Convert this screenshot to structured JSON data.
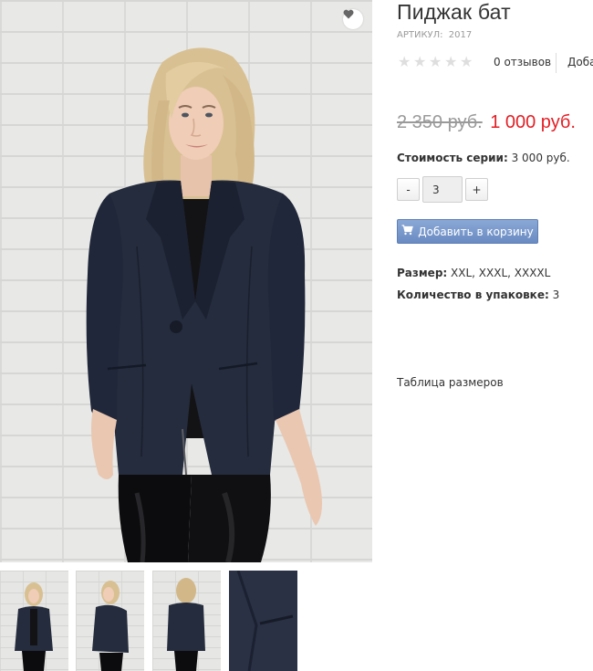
{
  "product": {
    "title": "Пиджак бат",
    "sku_label": "АРТИКУЛ:",
    "sku_value": "2017"
  },
  "rating": {
    "stars_filled": 0,
    "stars_total": 5,
    "reviews_label": "0 отзывов",
    "add_review_label": "Доба"
  },
  "price": {
    "old": "2 350 руб.",
    "new": "1 000 руб."
  },
  "series": {
    "label": "Стоимость серии:",
    "value": "3 000 руб."
  },
  "quantity": {
    "minus_label": "-",
    "value": "3",
    "plus_label": "+"
  },
  "cart": {
    "button_label": "Добавить в корзину",
    "icon": "cart-icon"
  },
  "attributes": {
    "size_label": "Размер:",
    "size_value": "XXL, XXXL, XXXXL",
    "pack_label": "Количество в упаковке:",
    "pack_value": "3"
  },
  "links": {
    "size_table": "Таблица размеров"
  },
  "icons": {
    "wishlist": "heart-icon",
    "star": "star-icon"
  },
  "colors": {
    "price_new": "#e31e24",
    "price_old": "#9a9a9a",
    "cart_button": "#7b9bcf",
    "star_empty": "#dedede",
    "jacket": "#252c3d"
  },
  "gallery": {
    "thumbnail_count": 4
  }
}
